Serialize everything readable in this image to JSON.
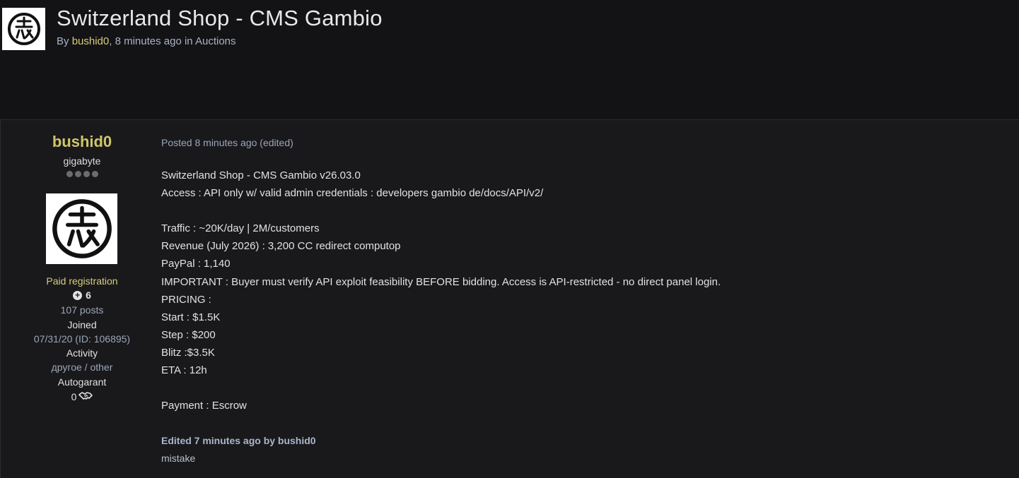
{
  "topic": {
    "title": "Switzerland Shop - CMS Gambio",
    "by_label": "By",
    "author": "bushid0",
    "time_ago": ", 8 minutes ago in ",
    "category": "Auctions"
  },
  "author_panel": {
    "name": "bushid0",
    "group": "gigabyte",
    "pip_count": 4,
    "member_status": "Paid registration",
    "reputation": "6",
    "posts": "107 posts",
    "joined_label": "Joined",
    "joined_value": "07/31/20 (ID: 106895)",
    "activity_label": "Activity",
    "activity_value": "другое / other",
    "autogarant_label": "Autogarant",
    "autogarant_value": "0"
  },
  "post": {
    "meta": "Posted 8 minutes ago (edited)",
    "lines": [
      "Switzerland Shop - CMS Gambio v26.03.0",
      "Access : API only w/ valid admin credentials  : developers gambio de/docs/API/v2/",
      "",
      "Traffic : ~20K/day | 2M/customers",
      "Revenue (July 2026) : 3,200 CC  redirect  computop",
      "PayPal : 1,140",
      "IMPORTANT : Buyer must verify API exploit feasibility BEFORE bidding. Access is API-restricted - no direct panel login.",
      "PRICING :",
      "Start : $1.5K",
      "Step : $200",
      "Blitz  :$3.5K",
      "ETA : 12h",
      "",
      "Payment : Escrow"
    ],
    "edited_by": "Edited 7 minutes ago by bushid0",
    "edit_reason": "mistake"
  },
  "icons": {
    "logo": "kanji-seal-icon",
    "reputation": "plus-circle-icon",
    "autogarant": "handshake-icon"
  }
}
